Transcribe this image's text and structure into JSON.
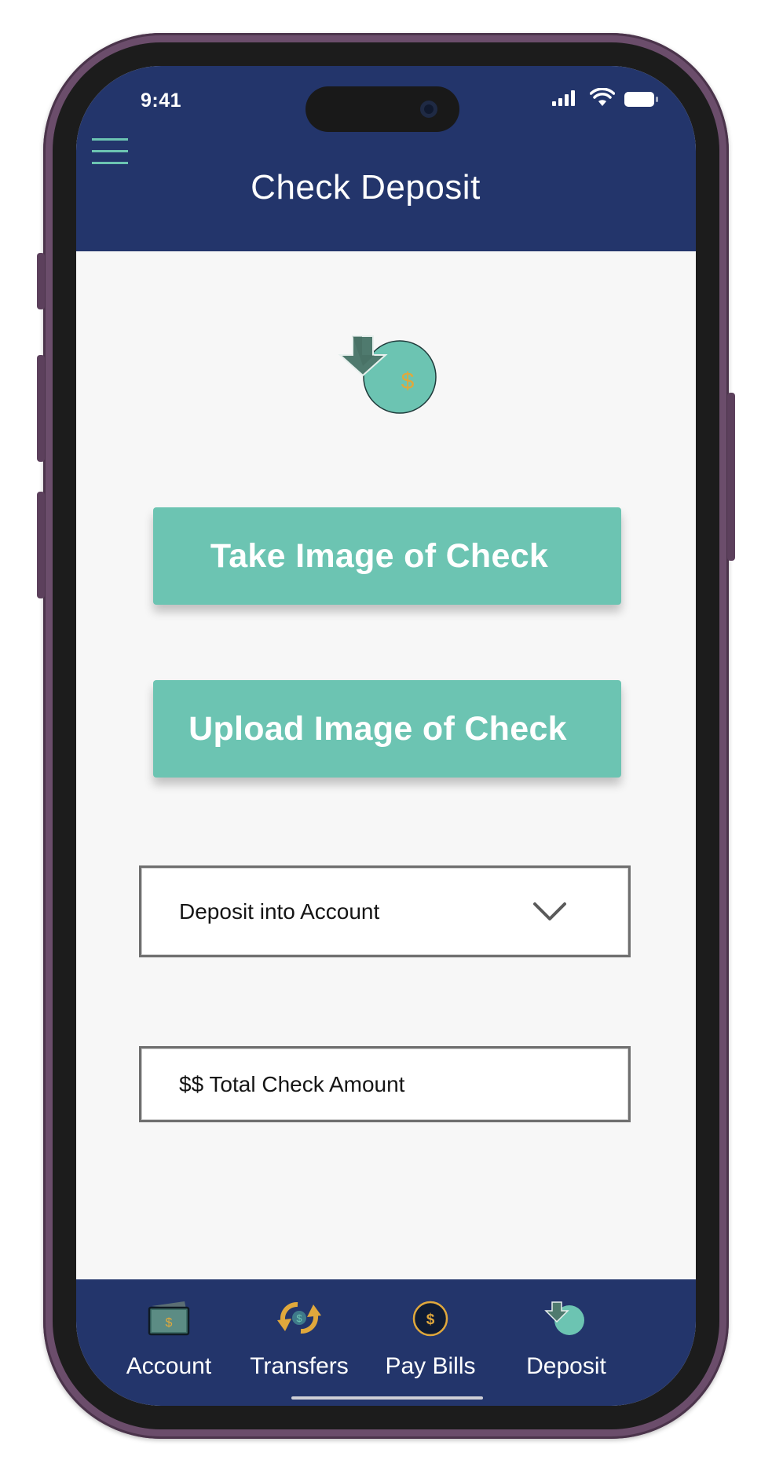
{
  "status_bar": {
    "time": "9:41"
  },
  "header": {
    "title": "Check Deposit",
    "menu_icon": "hamburger-menu-icon"
  },
  "hero": {
    "icon": "deposit-check-icon",
    "symbol": "$"
  },
  "actions": {
    "take_image_label": "Take Image of Check",
    "upload_image_label": "Upload Image of Check"
  },
  "form": {
    "account_select_value": "Deposit into Account",
    "amount_placeholder": "$$ Total Check Amount"
  },
  "bottom_nav": {
    "items": [
      {
        "label": "Account",
        "icon": "wallet-icon"
      },
      {
        "label": "Transfers",
        "icon": "transfer-arrows-icon"
      },
      {
        "label": "Pay Bills",
        "icon": "dollar-coin-icon"
      },
      {
        "label": "Deposit",
        "icon": "deposit-icon"
      }
    ]
  },
  "colors": {
    "navy": "#23356b",
    "teal": "#6cc4b2",
    "gold": "#e0a83c",
    "background": "#f7f7f7",
    "frame": "#6b4d6b"
  }
}
